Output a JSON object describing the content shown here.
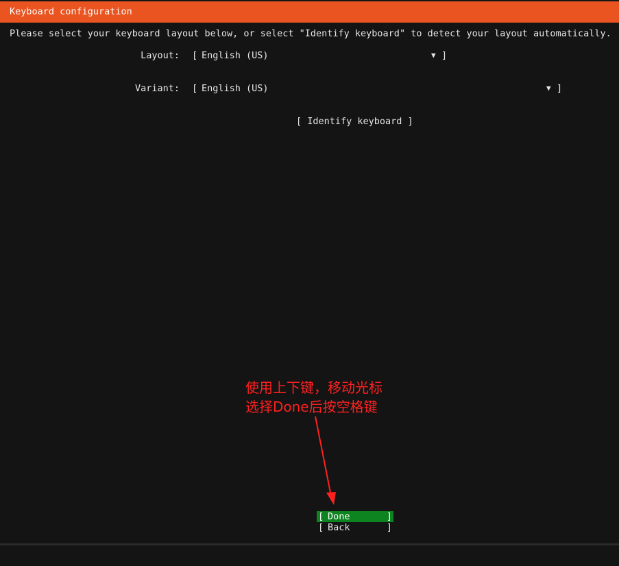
{
  "header": {
    "title": "Keyboard configuration"
  },
  "instructions": "Please select your keyboard layout below, or select \"Identify keyboard\" to detect your layout automatically.",
  "form": {
    "layout_label": "Layout:",
    "layout_value": "English (US)",
    "variant_label": "Variant:",
    "variant_value": "English (US)",
    "identify_button": "[ Identify keyboard ]"
  },
  "glyphs": {
    "open_bracket": "[",
    "close_bracket": "]",
    "dropdown_arrow": "▼"
  },
  "annotation": {
    "line1": "使用上下键，移动光标",
    "line2": "选择Done后按空格键",
    "color": "#ff2020"
  },
  "buttons": {
    "done_label": "Done",
    "back_label": "Back"
  },
  "colors": {
    "header": "#e95420",
    "background": "#141414",
    "selected_button": "#0e8420"
  }
}
